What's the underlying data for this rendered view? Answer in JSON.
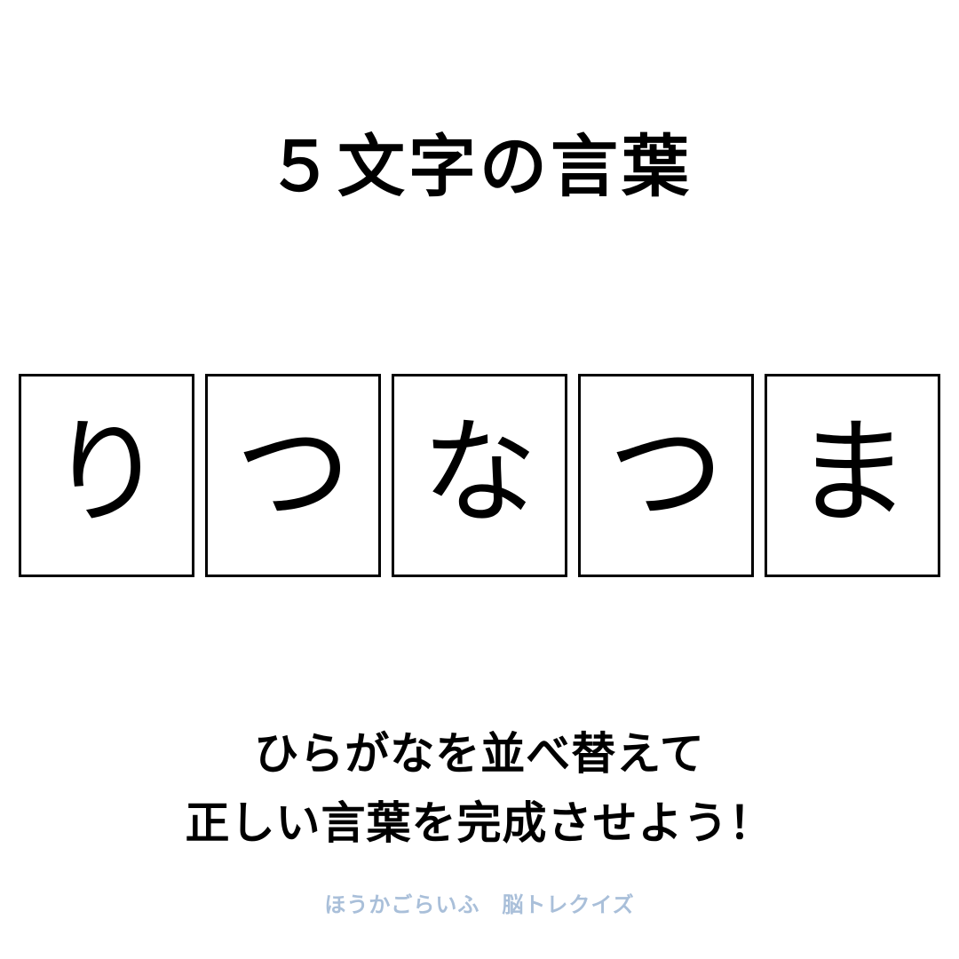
{
  "title": "５文字の言葉",
  "tiles": [
    {
      "char": "り"
    },
    {
      "char": "つ"
    },
    {
      "char": "な"
    },
    {
      "char": "つ"
    },
    {
      "char": "ま"
    }
  ],
  "instructions": {
    "line1": "ひらがなを並べ替えて",
    "line2": "正しい言葉を完成させよう！"
  },
  "footer": "ほうかごらいふ　脳トレクイズ",
  "colors": {
    "text": "#000000",
    "footer": "#a9bfd9",
    "background": "#ffffff"
  }
}
